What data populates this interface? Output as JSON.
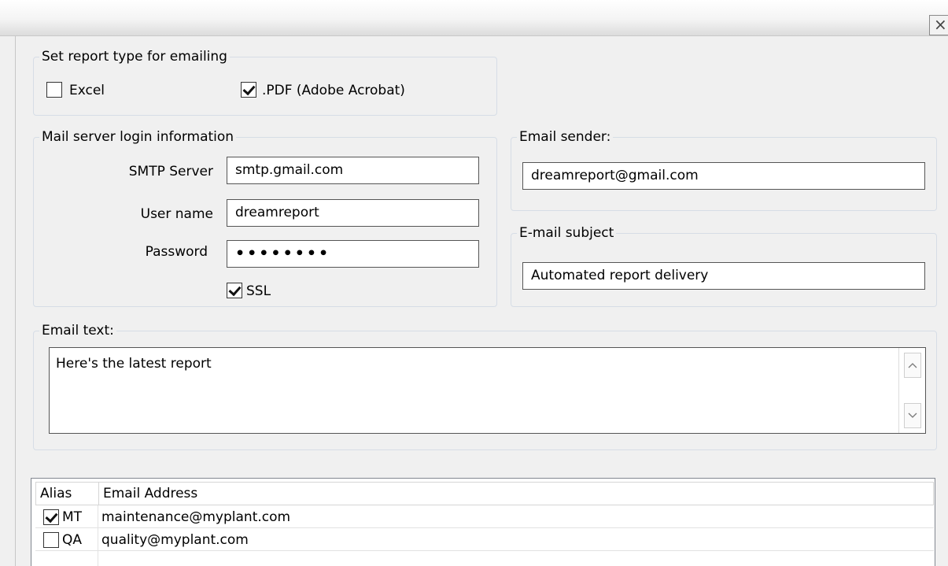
{
  "window": {
    "close_glyph": "×"
  },
  "report_type": {
    "legend": "Set report type for emailing",
    "options": [
      {
        "label": "Excel",
        "checked": false
      },
      {
        "label": ".PDF (Adobe Acrobat)",
        "checked": true
      }
    ]
  },
  "mail_server": {
    "legend": "Mail server login information",
    "smtp_label": "SMTP Server",
    "smtp_value": "smtp.gmail.com",
    "username_label": "User name",
    "username_value": "dreamreport",
    "password_label": "Password",
    "password_mask": "••••••••",
    "ssl_label": "SSL",
    "ssl_checked": true
  },
  "sender": {
    "legend": "Email sender:",
    "value": "dreamreport@gmail.com"
  },
  "subject": {
    "legend": "E-mail subject",
    "value": "Automated report delivery"
  },
  "email_text": {
    "legend": "Email text:",
    "value": "Here's the latest report",
    "scroll_up_icon": "up-arrow",
    "scroll_down_icon": "down-arrow"
  },
  "recipients": {
    "columns": [
      "Alias",
      "Email Address"
    ],
    "rows": [
      {
        "checked": true,
        "alias": "MT",
        "email": "maintenance@myplant.com"
      },
      {
        "checked": false,
        "alias": "QA",
        "email": "quality@myplant.com"
      }
    ]
  }
}
